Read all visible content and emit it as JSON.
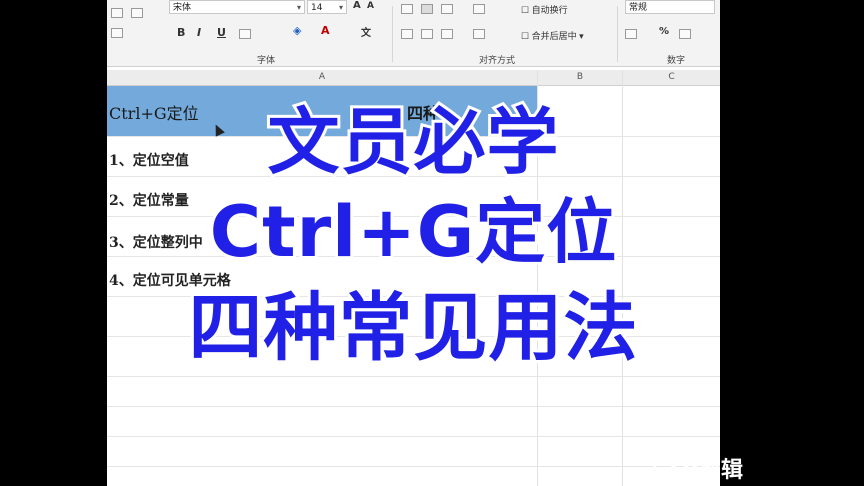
{
  "ribbon": {
    "font_name": "宋体",
    "font_size": "14",
    "bold_label": "B",
    "italic_label": "I",
    "underline_label": "U",
    "font_group_label": "字体",
    "wrap_text_label": "自动换行",
    "merge_center_label": "合并后居中",
    "alignment_group_label": "对齐方式",
    "number_format_value": "常规",
    "number_group_label": "数字",
    "percent_label": "%"
  },
  "sheet": {
    "columns": [
      "A",
      "B",
      "C"
    ],
    "title_cell": "Ctrl+G定位",
    "title_cell_right": "四种",
    "items": [
      "1、定位空值",
      "2、定位常量",
      "3、定位整列中",
      "4、定位可见单元格"
    ]
  },
  "overlay": {
    "line1": "文员必学",
    "line2": "Ctrl+G定位",
    "line3": "四种常见用法"
  },
  "watermark": {
    "text": "V剪辑",
    "color": "#ffffff"
  },
  "colors": {
    "title_fill": "#5b9bd5",
    "overlay_text": "#2020e6"
  }
}
